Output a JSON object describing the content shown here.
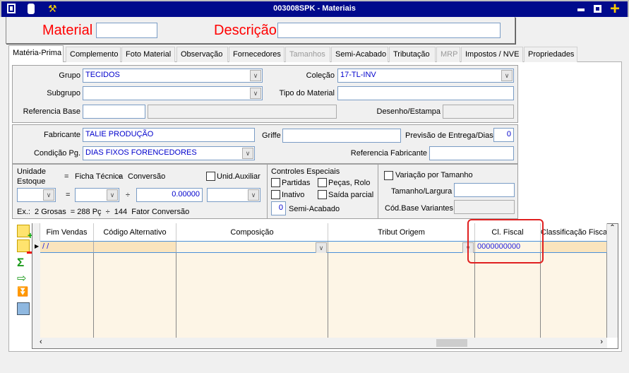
{
  "window": {
    "title": "003008SPK - Materiais",
    "icons": [
      "menu-icon",
      "traffic-light-icon",
      "wrench-icon"
    ],
    "controls": [
      "minimize",
      "maximize",
      "close-plus"
    ]
  },
  "header": {
    "material_label": "Material",
    "material_value": "",
    "descricao_label": "Descrição",
    "descricao_value": ""
  },
  "tabs": [
    {
      "label": "Matéria-Prima",
      "selected": true
    },
    {
      "label": "Complemento"
    },
    {
      "label": "Foto Material"
    },
    {
      "label": "Observação"
    },
    {
      "label": "Fornecedores"
    },
    {
      "label": "Tamanhos",
      "disabled": true
    },
    {
      "label": "Semi-Acabado"
    },
    {
      "label": "Tributação"
    },
    {
      "label": "MRP",
      "disabled": true
    },
    {
      "label": "Impostos / NVE"
    },
    {
      "label": "Propriedades"
    }
  ],
  "form": {
    "grupo_label": "Grupo",
    "grupo": "TECIDOS",
    "subgrupo_label": "Subgrupo",
    "subgrupo": "",
    "ref_base_label": "Referencia Base",
    "ref_base": "",
    "ref_base_desc": "",
    "colecao_label": "Coleção",
    "colecao": "17-TL-INV",
    "tipo_label": "Tipo do Material",
    "tipo": "",
    "desenho_label": "Desenho/Estampa",
    "desenho": "",
    "fabricante_label": "Fabricante",
    "fabricante": "TALIE PRODUÇÃO",
    "condicao_label": "Condição Pg.",
    "condicao": "DIAS FIXOS FORENCEDORES",
    "griffe_label": "Griffe",
    "griffe": "",
    "previsao_label": "Previsão de Entrega/Dias",
    "previsao": "0",
    "ref_fab_label": "Referencia Fabricante",
    "ref_fab": ""
  },
  "unidade": {
    "unidade_label1": "Unidade",
    "unidade_label2": "Estoque",
    "eq": "=",
    "ficha_label": "Ficha Técnica",
    "div": "÷",
    "conversao_label": "Conversão",
    "unid_aux_label": "Unid.Auxiliar",
    "conversao": "0.00000",
    "example": "Ex.:  2 Grosas  = 288 Pç  ÷  144  Fator Conversão"
  },
  "controles": {
    "title": "Controles Especiais",
    "partidas": "Partidas",
    "pecas": "Peças, Rolo",
    "inativo": "Inativo",
    "saida": "Saída parcial",
    "semi_value": "0",
    "semi_label": "Semi-Acabado"
  },
  "variacao": {
    "label": "Variação por Tamanho",
    "tamanho_label": "Tamanho/Largura",
    "tamanho": "",
    "cod_label": "Cód.Base Variantes",
    "cod": ""
  },
  "grid": {
    "columns": [
      "Fim Vendas",
      "Código Alternativo",
      "Composição",
      "Tribut Origem",
      "Cl. Fiscal",
      "Classificação Fiscal"
    ],
    "rows": [
      [
        "/ /",
        "",
        "",
        "",
        "0000000000",
        ""
      ]
    ]
  },
  "colors": {
    "title_bar": "#000a8c",
    "label_red": "#ff0000",
    "highlight": "#e02020",
    "row": "#fae4bd"
  }
}
